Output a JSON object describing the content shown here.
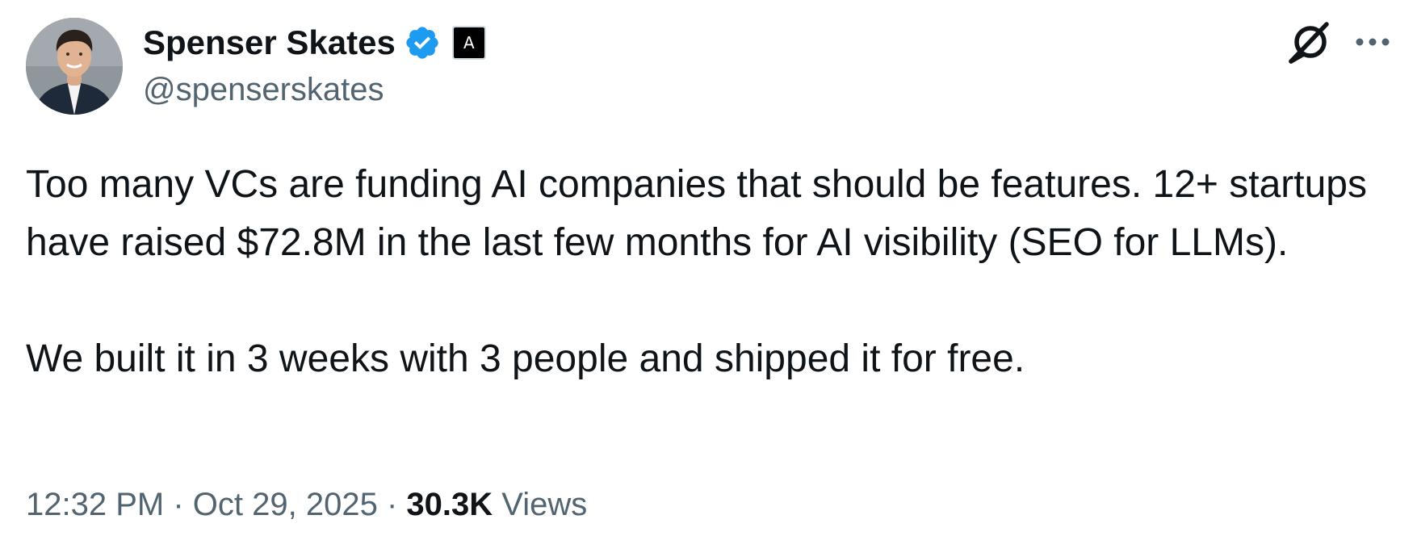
{
  "author": {
    "name": "Spenser Skates",
    "handle": "@spenserskates",
    "verified_color": "#1d9bf0",
    "affiliate_badge_glyph": "A"
  },
  "tweet": {
    "paragraph_1": "Too many VCs are funding AI companies that should be features. 12+ startups have raised $72.8M in the last few months for AI visibility (SEO for LLMs).",
    "paragraph_2": "We built it in 3 weeks with 3 people and shipped it for free."
  },
  "meta": {
    "time": "12:32 PM",
    "separator": "·",
    "date": "Oct 29, 2025",
    "views_count": "30.3K",
    "views_label": "Views"
  },
  "icons": {
    "grok": "grok-icon",
    "more": "more-icon"
  }
}
